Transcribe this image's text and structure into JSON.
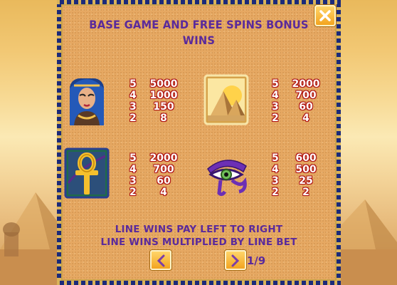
{
  "title": "BASE GAME AND FREE SPINS BONUS WINS",
  "symbols": [
    {
      "icon": "cleopatra-icon",
      "rows": [
        {
          "count": "5",
          "value": "5000"
        },
        {
          "count": "4",
          "value": "1000"
        },
        {
          "count": "3",
          "value": "150"
        },
        {
          "count": "2",
          "value": "8"
        }
      ]
    },
    {
      "icon": "pyramids-icon",
      "rows": [
        {
          "count": "5",
          "value": "2000"
        },
        {
          "count": "4",
          "value": "700"
        },
        {
          "count": "3",
          "value": "60"
        },
        {
          "count": "2",
          "value": "4"
        }
      ]
    },
    {
      "icon": "ankh-icon",
      "rows": [
        {
          "count": "5",
          "value": "2000"
        },
        {
          "count": "4",
          "value": "700"
        },
        {
          "count": "3",
          "value": "60"
        },
        {
          "count": "2",
          "value": "4"
        }
      ]
    },
    {
      "icon": "eye-of-horus-icon",
      "rows": [
        {
          "count": "5",
          "value": "600"
        },
        {
          "count": "4",
          "value": "500"
        },
        {
          "count": "3",
          "value": "25"
        },
        {
          "count": "2",
          "value": "2"
        }
      ]
    }
  ],
  "info": {
    "line1": "LINE WINS PAY LEFT TO RIGHT",
    "line2": "LINE WINS MULTIPLIED BY LINE BET"
  },
  "pagination": {
    "label": "1/9",
    "prev_icon": "chevron-left-icon",
    "next_icon": "chevron-right-icon"
  },
  "close_icon": "close-icon",
  "colors": {
    "title": "#5a2a9b",
    "frame": "#1b2a7a",
    "gold": "#f3a41f",
    "value_outline": "#b11515"
  }
}
